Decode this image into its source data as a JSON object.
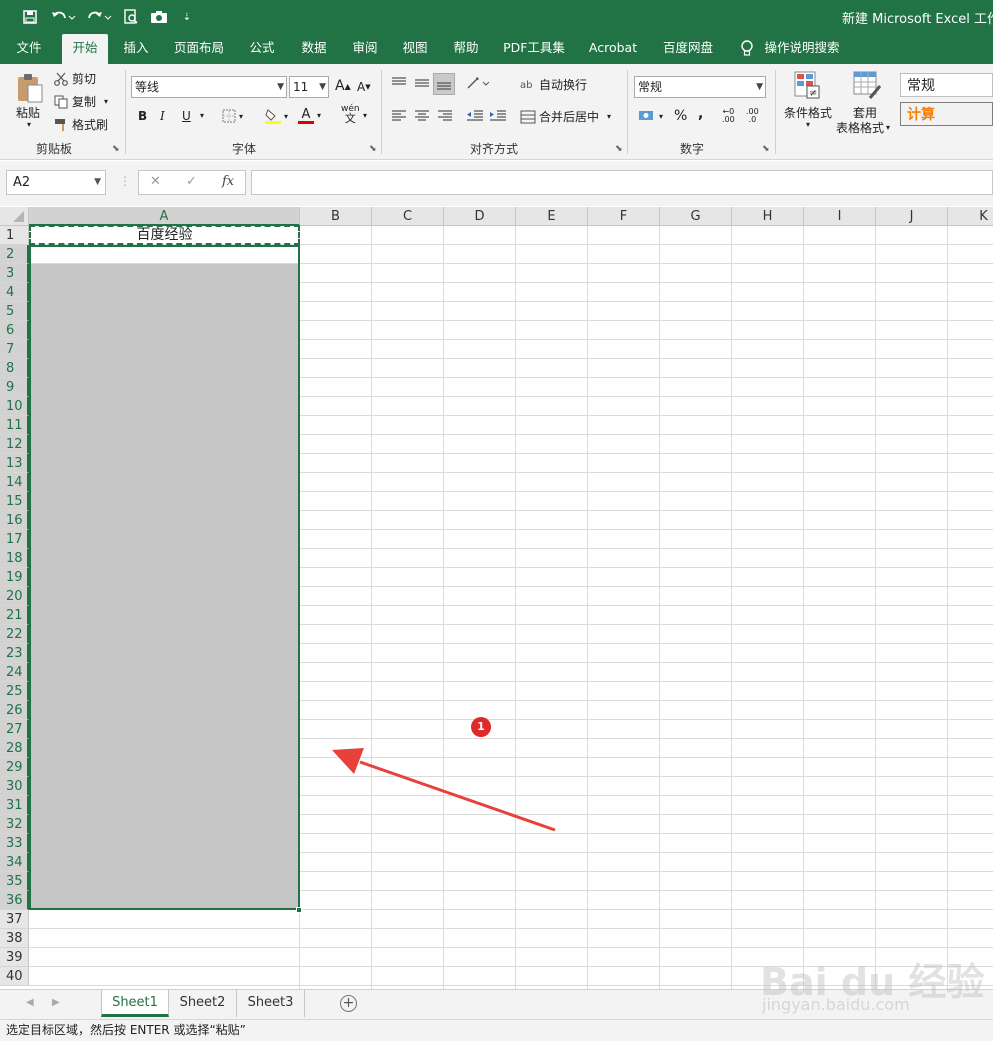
{
  "app": {
    "title": "新建 Microsoft Excel 工作表",
    "accent_color": "#217346"
  },
  "quick_access": {
    "icons": [
      "save-icon",
      "undo-icon",
      "redo-icon",
      "print-preview-icon",
      "camera-icon",
      "customize-icon"
    ]
  },
  "tabs": [
    {
      "label": "文件"
    },
    {
      "label": "开始"
    },
    {
      "label": "插入"
    },
    {
      "label": "页面布局"
    },
    {
      "label": "公式"
    },
    {
      "label": "数据"
    },
    {
      "label": "审阅"
    },
    {
      "label": "视图"
    },
    {
      "label": "帮助"
    },
    {
      "label": "PDF工具集"
    },
    {
      "label": "Acrobat"
    },
    {
      "label": "百度网盘"
    },
    {
      "label": "操作说明搜索"
    }
  ],
  "ribbon": {
    "clipboard": {
      "group": "剪贴板",
      "paste": "粘贴",
      "cut": "剪切",
      "copy": "复制",
      "format_painter": "格式刷"
    },
    "font": {
      "group": "字体",
      "font_name": "等线",
      "font_size": "11",
      "bold": "B",
      "italic": "I",
      "underline": "U",
      "grow": "A",
      "shrink": "A",
      "color_letter": "A",
      "phonetic": "wén",
      "phonetic_sub": "文"
    },
    "alignment": {
      "group": "对齐方式",
      "wrap_text": "自动换行",
      "merge_center": "合并后居中"
    },
    "number": {
      "group": "数字",
      "format": "常规",
      "percent": "%",
      "comma": ",",
      "inc_decimal": ".00",
      "dec_decimal": ".0"
    },
    "styles": {
      "conditional": "条件格式",
      "table_format_1": "套用",
      "table_format_2": "表格格式",
      "style_normal": "常规",
      "style_calc": "计算",
      "calc_color": "#fa7d00"
    }
  },
  "formula_bar": {
    "name_box": "A2",
    "cancel": "✕",
    "enter": "✓",
    "fx": "fx",
    "content": ""
  },
  "grid": {
    "columns": [
      "A",
      "B",
      "C",
      "D",
      "E",
      "F",
      "G",
      "H",
      "I",
      "J",
      "K"
    ],
    "rows": [
      "1",
      "2",
      "3",
      "4",
      "5",
      "6",
      "7",
      "8",
      "9",
      "10",
      "11",
      "12",
      "13",
      "14",
      "15",
      "16",
      "17",
      "18",
      "19",
      "20",
      "21",
      "22",
      "23",
      "24",
      "25",
      "26",
      "27",
      "28",
      "29",
      "30",
      "31",
      "32",
      "33",
      "34",
      "35",
      "36",
      "37",
      "38",
      "39",
      "40"
    ],
    "cell_A1": "百度经验",
    "annotation_badge": "1"
  },
  "sheets": [
    {
      "label": "Sheet1"
    },
    {
      "label": "Sheet2"
    },
    {
      "label": "Sheet3"
    }
  ],
  "add_sheet": "+",
  "status": {
    "message": "选定目标区域，然后按 ENTER 或选择“粘贴”"
  },
  "watermark": {
    "brand": "Bai du 经验",
    "url": "jingyan.baidu.com"
  }
}
